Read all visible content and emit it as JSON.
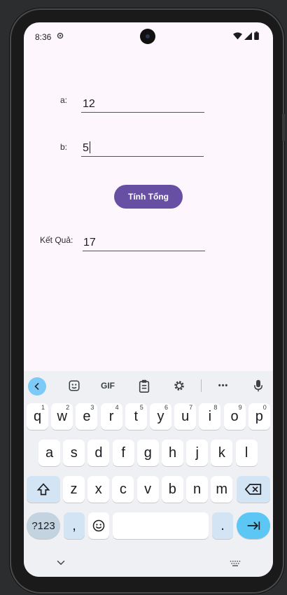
{
  "status_bar": {
    "time": "8:36"
  },
  "form": {
    "a_label": "a:",
    "a_value": "12",
    "b_label": "b:",
    "b_value": "5",
    "button_label": "Tính Tổng",
    "result_label": "Kết Quả:",
    "result_value": "17"
  },
  "keyboard": {
    "toolbar": {
      "gif_label": "GIF",
      "more_label": "•••"
    },
    "row1": [
      {
        "key": "q",
        "hint": "1"
      },
      {
        "key": "w",
        "hint": "2"
      },
      {
        "key": "e",
        "hint": "3"
      },
      {
        "key": "r",
        "hint": "4"
      },
      {
        "key": "t",
        "hint": "5"
      },
      {
        "key": "y",
        "hint": "6"
      },
      {
        "key": "u",
        "hint": "7"
      },
      {
        "key": "i",
        "hint": "8"
      },
      {
        "key": "o",
        "hint": "9"
      },
      {
        "key": "p",
        "hint": "0"
      }
    ],
    "row2": [
      "a",
      "s",
      "d",
      "f",
      "g",
      "h",
      "j",
      "k",
      "l"
    ],
    "row3": [
      "z",
      "x",
      "c",
      "v",
      "b",
      "n",
      "m"
    ],
    "symbols_label": "?123",
    "comma_label": ",",
    "period_label": "."
  },
  "colors": {
    "accent": "#6750a4",
    "background": "#fdf7fd",
    "keyboard_bg": "#eef0f3"
  }
}
